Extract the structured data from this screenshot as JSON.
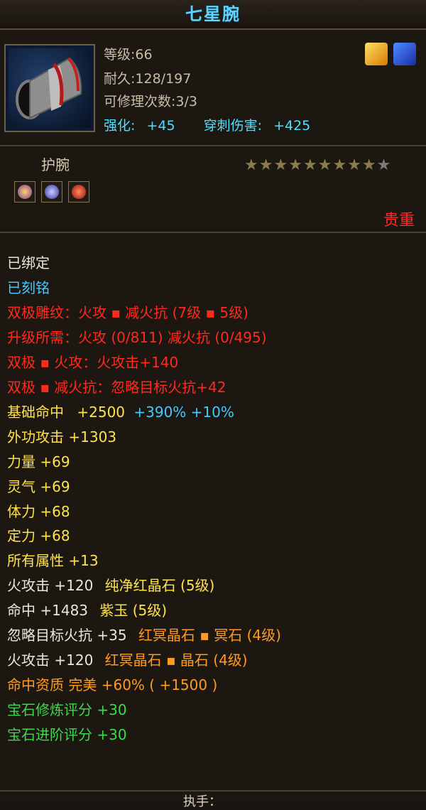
{
  "title": "七星腕",
  "header": {
    "level": "等级:66",
    "durability": "耐久:128/197",
    "repair_count": "可修理次数:3/3",
    "enhance_label": "强化:",
    "enhance_value": "+45",
    "pierce_label": "穿刺伤害:",
    "pierce_value": "+425"
  },
  "item_type": "护腕",
  "rarity": "贵重",
  "stars": {
    "filled": 9,
    "total": 10
  },
  "props": {
    "bound": "已绑定",
    "engraved": "已刻铭",
    "dual_carve": "双极雕纹：火攻 ▪ 减火抗 (7级 ▪ 5级)",
    "upgrade_need": "升级所需：火攻 (0/811)  减火抗 (0/495)",
    "dual_fire": "双极 ▪ 火攻：火攻击+140",
    "dual_resist": "双极 ▪ 减火抗：忽略目标火抗+42",
    "hit_base_label": "基础命中",
    "hit_base_value": "+2500",
    "hit_base_extra": "+390% +10%",
    "outer_attack": "外功攻击  +1303",
    "strength": "力量  +69",
    "spirit": "灵气  +69",
    "stamina": "体力  +68",
    "focus": "定力  +68",
    "all_attr": "所有属性  +13",
    "fire_atk_1_label": "火攻击  +120",
    "fire_atk_1_gem": "纯净红晶石 (5级)",
    "hit_label": "命中  +1483",
    "hit_gem": "紫玉 (5级)",
    "ignore_fire_label": "忽略目标火抗  +35",
    "ignore_fire_gem": "红冥晶石 ▪ 冥石 (4级)",
    "fire_atk_2_label": "火攻击  +120",
    "fire_atk_2_gem": "红冥晶石 ▪ 晶石 (4级)",
    "hit_quality": "命中资质   完美 +60% ( +1500 )",
    "gem_refine": "宝石修炼评分  +30",
    "gem_advance": "宝石进阶评分  +30"
  },
  "footer": "执手："
}
